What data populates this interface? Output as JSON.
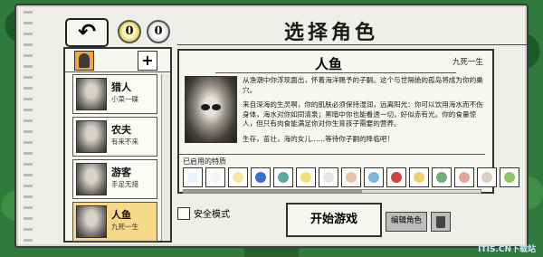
{
  "header": {
    "back_symbol": "↶",
    "coin_gold": "0",
    "coin_silver": "0",
    "title": "选择角色"
  },
  "roster": {
    "plus_symbol": "+",
    "characters": [
      {
        "name": "猎人",
        "sub": "小菜一碟",
        "selected": false
      },
      {
        "name": "农夫",
        "sub": "有来不来",
        "selected": false
      },
      {
        "name": "游客",
        "sub": "手足无措",
        "selected": false
      },
      {
        "name": "人鱼",
        "sub": "九死一生",
        "selected": true
      }
    ]
  },
  "detail": {
    "name": "人鱼",
    "nickname": "九死一生",
    "bio": [
      "从渔潮中你浮现面出，怀着海洋赐予的子嗣。这个与世隔绝的孤岛将成为你的巢穴。",
      "来自深海的生灵啊，你的肌肤必须保持湿润，远离阳光：你可以饮用海水而不伤身体，海水对你如同清泉；黑暗中你也能看透一切，好似赤有光。你的食量惊人，但只有肉食能满足你对你生育孩子需要的营养。",
      "生存，苗壮，海的女儿……等待你子嗣的降临吧！"
    ],
    "traits_label": "已启用的特质",
    "traits": [
      {
        "icon": "bubble-icon",
        "color": "#e9f4ff"
      },
      {
        "icon": "ring-icon",
        "color": "#f4f4f4"
      },
      {
        "icon": "coin-icon",
        "color": "#f6e6a0"
      },
      {
        "icon": "water-drop-icon",
        "color": "#3d6fd8"
      },
      {
        "icon": "face-icon",
        "color": "#5fa8a0"
      },
      {
        "icon": "moon-icon",
        "color": "#f2e27a"
      },
      {
        "icon": "plate-icon",
        "color": "#e7e7e7"
      },
      {
        "icon": "hand-icon",
        "color": "#e9c0a8"
      },
      {
        "icon": "fish-icon",
        "color": "#7ab6e0"
      },
      {
        "icon": "no-food-icon",
        "color": "#d24242"
      },
      {
        "icon": "island-icon",
        "color": "#f0d070"
      },
      {
        "icon": "flag-icon",
        "color": "#6fb07a"
      },
      {
        "icon": "meat-icon",
        "color": "#e7a59a"
      },
      {
        "icon": "egg-icon",
        "color": "#d9d0c2"
      },
      {
        "icon": "leaf-icon",
        "color": "#8dc46e"
      }
    ]
  },
  "actions": {
    "safe_mode_label": "安全模式",
    "start_label": "开始游戏",
    "edit_label": "编辑角色"
  },
  "watermark": "ITIS.CN下载站"
}
